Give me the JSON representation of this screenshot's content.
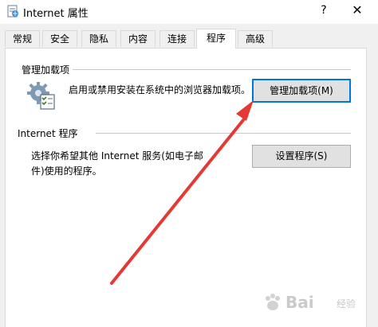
{
  "window": {
    "title": "Internet 属性",
    "help_symbol": "?",
    "close_symbol": "✕",
    "app_icon": "internet-options-icon"
  },
  "tabs": [
    {
      "label": "常规",
      "active": false
    },
    {
      "label": "安全",
      "active": false
    },
    {
      "label": "隐私",
      "active": false
    },
    {
      "label": "内容",
      "active": false
    },
    {
      "label": "连接",
      "active": false
    },
    {
      "label": "程序",
      "active": true
    },
    {
      "label": "高级",
      "active": false
    }
  ],
  "addons": {
    "group_title": "管理加载项",
    "description": "启用或禁用安装在系统中的浏览器加载项。",
    "button_label": "管理加载项(M)",
    "icon": "addons-gear-icon"
  },
  "programs": {
    "group_title": "Internet 程序",
    "description_line1": "选择你希望其他 Internet 服务(如电子邮",
    "description_line2": "件)使用的程序。",
    "button_label": "设置程序(S)"
  },
  "annotation": {
    "arrow_color": "#e53935"
  },
  "watermark": {
    "text": "Bai",
    "sub_text": "经验"
  }
}
